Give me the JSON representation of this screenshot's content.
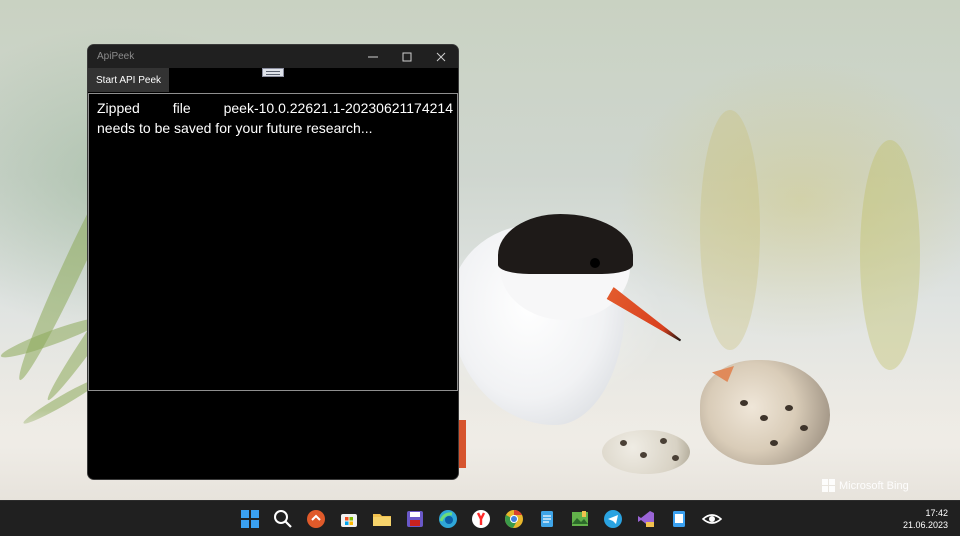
{
  "window": {
    "title": "ApiPeek",
    "start_button_label": "Start API Peek",
    "output": {
      "line1_words": [
        "Zipped",
        "file",
        "peek-10.0.22621.1-20230621174214"
      ],
      "line2": "needs to be saved for your future research..."
    }
  },
  "wallpaper": {
    "watermark": "Microsoft Bing"
  },
  "taskbar": {
    "icons": [
      {
        "name": "start-icon",
        "color": "#3aa0f0"
      },
      {
        "name": "search-icon",
        "color": "#ffffff"
      },
      {
        "name": "remote-desktop-icon",
        "color": "#e05a2a"
      },
      {
        "name": "microsoft-store-icon",
        "color": "#f0f0f0"
      },
      {
        "name": "file-explorer-icon",
        "color": "#f2c14e"
      },
      {
        "name": "save-app-icon",
        "color": "#6a58c8"
      },
      {
        "name": "edge-icon",
        "color": "#2fa7d8"
      },
      {
        "name": "yandex-browser-icon",
        "color": "#ff2a2a"
      },
      {
        "name": "chrome-icon",
        "color": "#e8b72c"
      },
      {
        "name": "notepad-icon",
        "color": "#3fa5e8"
      },
      {
        "name": "image-editor-icon",
        "color": "#62b14a"
      },
      {
        "name": "telegram-icon",
        "color": "#2aa3e1"
      },
      {
        "name": "visual-studio-icon",
        "color": "#9a64d6"
      },
      {
        "name": "app-tablet-icon",
        "color": "#3aa0f0"
      },
      {
        "name": "eye-icon",
        "color": "#ffffff"
      }
    ],
    "time": "17:42",
    "date": "21.06.2023"
  }
}
